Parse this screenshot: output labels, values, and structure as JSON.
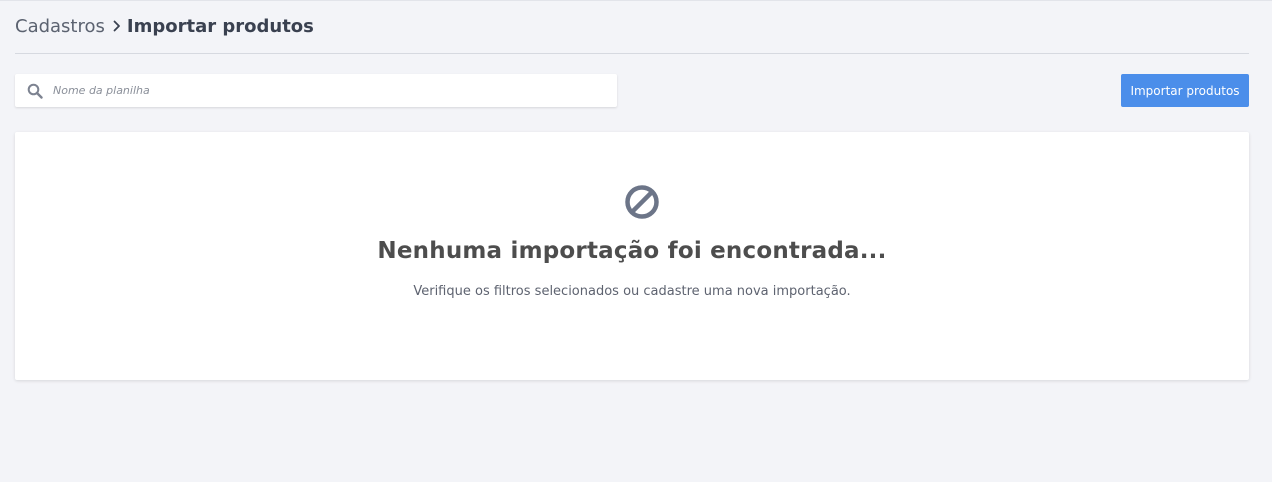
{
  "breadcrumb": {
    "parent": "Cadastros",
    "current": "Importar produtos",
    "separator_icon": "chevron-right-icon"
  },
  "search": {
    "icon": "search-icon",
    "placeholder": "Nome da planilha",
    "value": ""
  },
  "actions": {
    "import_label": "Importar produtos"
  },
  "empty_state": {
    "icon": "block-icon",
    "title": "Nenhuma importação foi encontrada...",
    "subtitle": "Verifique os filtros selecionados ou cadastre uma nova importação."
  },
  "colors": {
    "background": "#f3f4f8",
    "accent": "#4b8eea",
    "icon_gray": "#6c7588",
    "text_dark": "#3a4150"
  }
}
